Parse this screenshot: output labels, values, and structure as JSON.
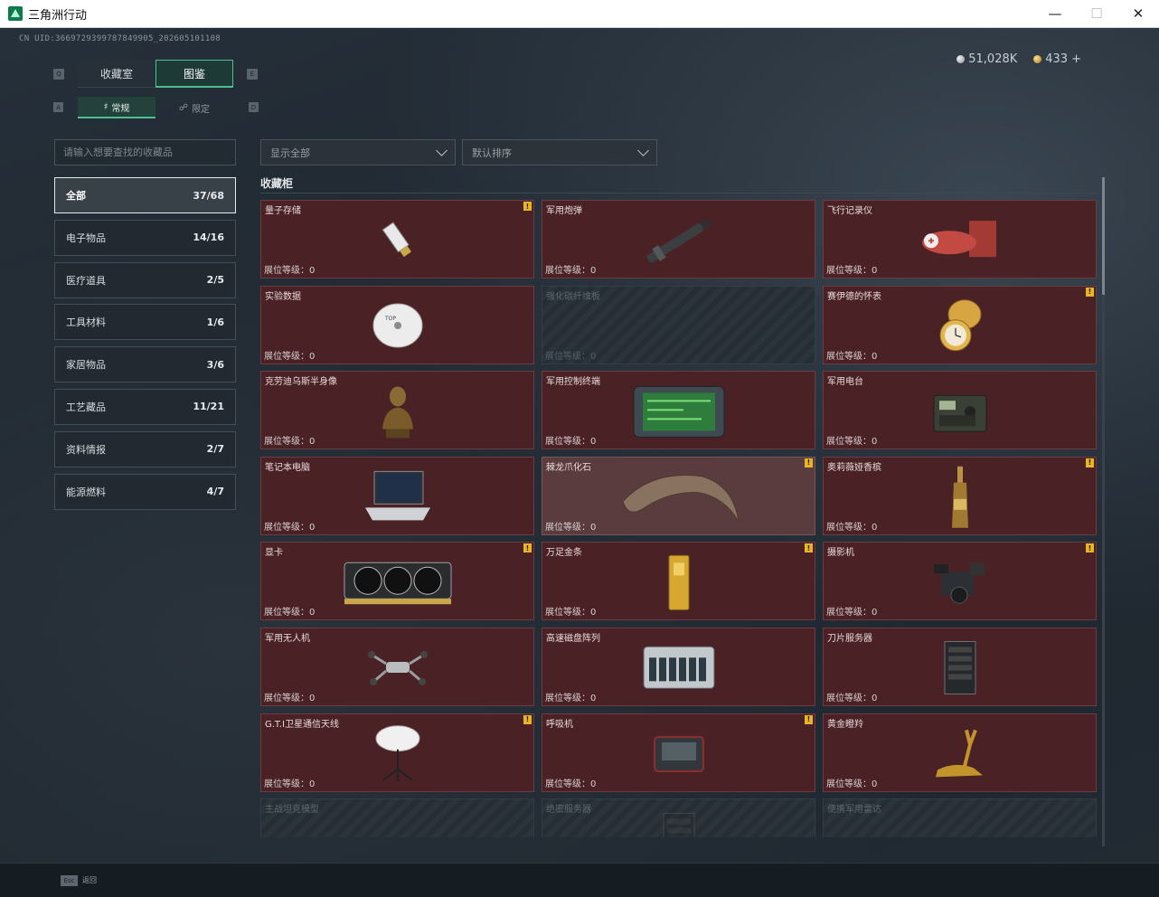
{
  "window": {
    "title": "三角洲行动",
    "controls": [
      "minimize",
      "maximize",
      "close"
    ]
  },
  "uid": "CN UID:3669729399787849905_202605101108",
  "currency": {
    "silver": "51,028K",
    "gold": "433",
    "add": "+"
  },
  "tabs": [
    {
      "label": "收藏室",
      "key": "Q",
      "active": false
    },
    {
      "label": "图鉴",
      "key": "E",
      "active": true
    }
  ],
  "subtabs": [
    {
      "label": "常规",
      "active": true
    },
    {
      "label": "限定",
      "active": false
    }
  ],
  "search": {
    "placeholder": "请输入想要查找的收藏品"
  },
  "filters": {
    "display": "显示全部",
    "sort": "默认排序"
  },
  "categories": [
    {
      "name": "全部",
      "count": "37/68",
      "active": true
    },
    {
      "name": "电子物品",
      "count": "14/16",
      "active": false
    },
    {
      "name": "医疗道具",
      "count": "2/5",
      "active": false
    },
    {
      "name": "工具材料",
      "count": "1/6",
      "active": false
    },
    {
      "name": "家居物品",
      "count": "3/6",
      "active": false
    },
    {
      "name": "工艺藏品",
      "count": "11/21",
      "active": false
    },
    {
      "name": "资料情报",
      "count": "2/7",
      "active": false
    },
    {
      "name": "能源燃料",
      "count": "4/7",
      "active": false
    }
  ],
  "section": {
    "label": "收藏柜"
  },
  "items": [
    {
      "name": "量子存储",
      "level": "展位等级：0",
      "badge": true,
      "locked": false,
      "icon": "usb-drive-icon"
    },
    {
      "name": "军用炮弹",
      "level": "展位等级：0",
      "badge": false,
      "locked": false,
      "icon": "shell-icon"
    },
    {
      "name": "飞行记录仪",
      "level": "展位等级：0",
      "badge": false,
      "locked": false,
      "icon": "flight-recorder-icon"
    },
    {
      "name": "实验数据",
      "level": "展位等级：0",
      "badge": false,
      "locked": false,
      "icon": "disc-icon"
    },
    {
      "name": "强化碳纤维板",
      "level": "展位等级：0",
      "badge": false,
      "locked": true,
      "icon": "carbon-plate-icon"
    },
    {
      "name": "赛伊德的怀表",
      "level": "展位等级：0",
      "badge": true,
      "locked": false,
      "icon": "pocket-watch-icon"
    },
    {
      "name": "克劳迪乌斯半身像",
      "level": "展位等级：0",
      "badge": false,
      "locked": false,
      "icon": "bust-icon"
    },
    {
      "name": "军用控制终端",
      "level": "展位等级：0",
      "badge": false,
      "locked": false,
      "icon": "terminal-icon"
    },
    {
      "name": "军用电台",
      "level": "展位等级：0",
      "badge": false,
      "locked": false,
      "icon": "radio-icon"
    },
    {
      "name": "笔记本电脑",
      "level": "展位等级：0",
      "badge": false,
      "locked": false,
      "icon": "laptop-icon"
    },
    {
      "name": "棘龙爪化石",
      "level": "展位等级：0",
      "badge": true,
      "locked": false,
      "highlight": true,
      "icon": "claw-fossil-icon"
    },
    {
      "name": "奥莉薇娅香槟",
      "level": "展位等级：0",
      "badge": true,
      "locked": false,
      "icon": "champagne-icon"
    },
    {
      "name": "显卡",
      "level": "展位等级：0",
      "badge": true,
      "locked": false,
      "icon": "gpu-icon"
    },
    {
      "name": "万足金条",
      "level": "展位等级：0",
      "badge": true,
      "locked": false,
      "icon": "gold-bar-icon"
    },
    {
      "name": "摄影机",
      "level": "展位等级：0",
      "badge": true,
      "locked": false,
      "icon": "camera-icon"
    },
    {
      "name": "军用无人机",
      "level": "展位等级：0",
      "badge": false,
      "locked": false,
      "icon": "drone-icon"
    },
    {
      "name": "高速磁盘阵列",
      "level": "展位等级：0",
      "badge": false,
      "locked": false,
      "icon": "disk-array-icon"
    },
    {
      "name": "刀片服务器",
      "level": "展位等级：0",
      "badge": false,
      "locked": false,
      "icon": "server-icon"
    },
    {
      "name": "G.T.I卫星通信天线",
      "level": "展位等级：0",
      "badge": true,
      "locked": false,
      "icon": "satellite-dish-icon"
    },
    {
      "name": "呼吸机",
      "level": "展位等级：0",
      "badge": true,
      "locked": false,
      "icon": "ventilator-icon"
    },
    {
      "name": "黄金瞪羚",
      "level": "展位等级：0",
      "badge": false,
      "locked": false,
      "icon": "gazelle-icon"
    },
    {
      "name": "主战坦克模型",
      "level": "",
      "badge": false,
      "locked": true,
      "icon": "tank-icon"
    },
    {
      "name": "绝密服务器",
      "level": "",
      "badge": false,
      "locked": true,
      "icon": "server-icon"
    },
    {
      "name": "便携军用雷达",
      "level": "",
      "badge": false,
      "locked": true,
      "icon": "radar-icon"
    }
  ],
  "footer": {
    "esc_key": "Esc",
    "back_label": "返回"
  },
  "colors": {
    "accent": "#4fc08d",
    "card_bg": "#4a2226",
    "badge": "#e8b623"
  }
}
